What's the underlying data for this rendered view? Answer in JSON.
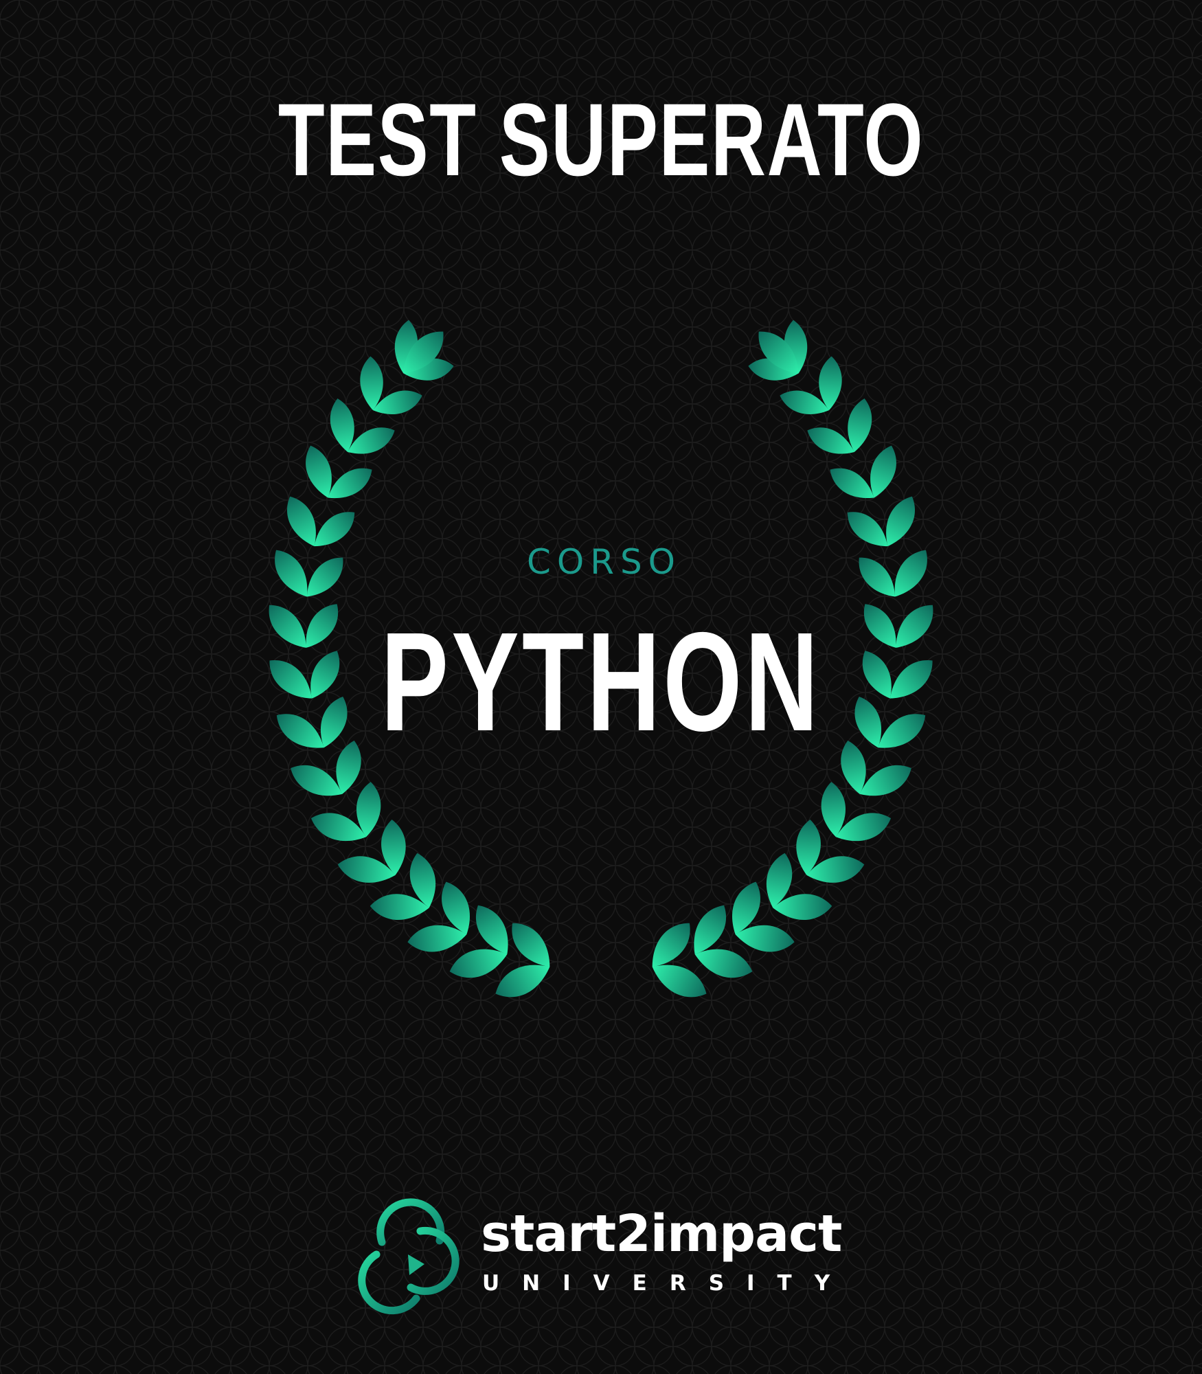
{
  "poster": {
    "heading": "TEST SUPERATO",
    "kicker": "CORSO",
    "course": "PYTHON",
    "icon": "laurel-wreath-icon"
  },
  "brand": {
    "name": "start2impact",
    "sub": "UNIVERSITY",
    "icon": "logo-rings-icon"
  },
  "colors": {
    "background": "#0c0c0c",
    "pattern": "#1d1d1d",
    "heading": "#ffffff",
    "kicker": "#1b9a8c",
    "leaf_light": "#22e5a2",
    "leaf_dark": "#0f6e5e"
  }
}
